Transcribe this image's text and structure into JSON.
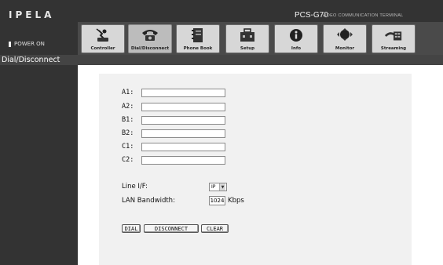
{
  "header": {
    "logo": "IPELA",
    "power_status": "POWER ON",
    "model": "PCS-G70",
    "model_subtitle": "VIDEO COMMUNICATION TERMINAL"
  },
  "toolbar": {
    "active": "Dial/Disconnect",
    "items": [
      {
        "label": "Controller",
        "icon": "controller-icon"
      },
      {
        "label": "Dial/Disconnect",
        "icon": "phone-icon"
      },
      {
        "label": "Phone Book",
        "icon": "phone-book-icon"
      },
      {
        "label": "Setup",
        "icon": "setup-toolbox-icon"
      },
      {
        "label": "Info",
        "icon": "info-icon"
      },
      {
        "label": "Monitor",
        "icon": "monitor-icon"
      },
      {
        "label": "Streaming",
        "icon": "streaming-icon"
      }
    ]
  },
  "page": {
    "title": "Dial/Disconnect"
  },
  "form": {
    "fields": [
      {
        "label": "A1:",
        "value": ""
      },
      {
        "label": "A2:",
        "value": ""
      },
      {
        "label": "B1:",
        "value": ""
      },
      {
        "label": "B2:",
        "value": ""
      },
      {
        "label": "C1:",
        "value": ""
      },
      {
        "label": "C2:",
        "value": ""
      }
    ],
    "line_if": {
      "label": "Line I/F:",
      "value": "IP"
    },
    "lan_bandwidth": {
      "label": "LAN Bandwidth:",
      "value": "1024",
      "unit": "Kbps"
    }
  },
  "buttons": {
    "dial": "DIAL",
    "disconnect": "DISCONNECT",
    "clear": "CLEAR"
  },
  "colors": {
    "header_bg": "#333333",
    "panel_bg": "#f1f1f1",
    "button_bg": "#d7d7d7"
  }
}
